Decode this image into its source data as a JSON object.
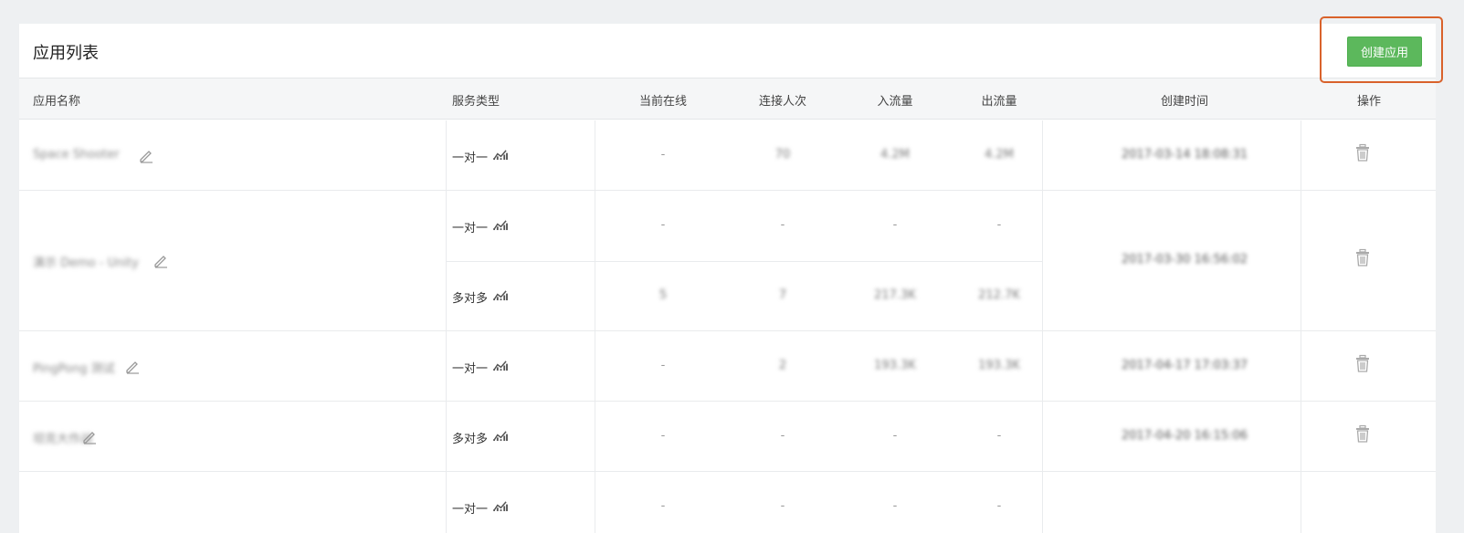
{
  "panel": {
    "title": "应用列表",
    "create_button": "创建应用"
  },
  "columns": [
    "应用名称",
    "服务类型",
    "当前在线",
    "连接人次",
    "入流量",
    "出流量",
    "创建时间",
    "操作"
  ],
  "rows": [
    {
      "name": "Space Shooter",
      "created": "2017-03-14 18:08:31",
      "services": [
        {
          "type": "一对一",
          "online": "-",
          "connections": "70",
          "in": "4.2M",
          "out": "4.2M"
        }
      ]
    },
    {
      "name": "演示 Demo - Unity",
      "created": "2017-03-30 16:56:02",
      "services": [
        {
          "type": "一对一",
          "online": "-",
          "connections": "-",
          "in": "-",
          "out": "-"
        },
        {
          "type": "多对多",
          "online": "5",
          "connections": "7",
          "in": "217.3K",
          "out": "212.7K"
        }
      ]
    },
    {
      "name": "PingPong 测试",
      "created": "2017-04-17 17:03:37",
      "services": [
        {
          "type": "一对一",
          "online": "-",
          "connections": "2",
          "in": "193.3K",
          "out": "193.3K"
        }
      ]
    },
    {
      "name": "坦克大作战",
      "created": "2017-04-20 16:15:06",
      "services": [
        {
          "type": "多对多",
          "online": "-",
          "connections": "-",
          "in": "-",
          "out": "-"
        }
      ]
    },
    {
      "name": "",
      "created": "",
      "services": [
        {
          "type": "一对一",
          "online": "-",
          "connections": "-",
          "in": "-",
          "out": "-"
        }
      ]
    }
  ],
  "icons": {
    "edit": "pencil-icon",
    "chart": "chart-icon",
    "delete": "trash-icon"
  },
  "colors": {
    "accent": "#5cb85c",
    "highlight": "#d9622b"
  }
}
